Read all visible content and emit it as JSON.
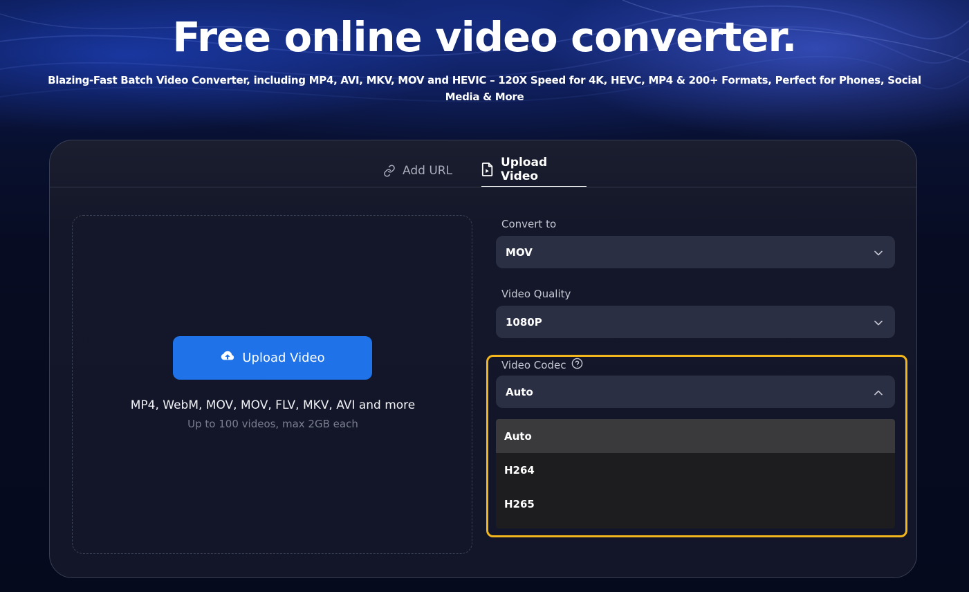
{
  "hero": {
    "title": "Free online video converter.",
    "subtitle": "Blazing-Fast Batch Video Converter, including MP4, AVI, MKV, MOV and HEVIC – 120X Speed for 4K, HEVC, MP4 & 200+ Formats, Perfect for Phones, Social Media & More"
  },
  "tabs": [
    {
      "label": "Add URL",
      "icon": "link-icon",
      "active": false
    },
    {
      "label": "Upload Video",
      "icon": "file-video-icon",
      "active": true
    }
  ],
  "upload": {
    "button_label": "Upload Video",
    "button_icon": "cloud-upload-icon",
    "formats": "MP4, WebM, MOV, MOV, FLV, MKV, AVI and more",
    "limits": "Up to 100 videos, max 2GB each"
  },
  "convert_to": {
    "label": "Convert to",
    "value": "MOV"
  },
  "video_quality": {
    "label": "Video Quality",
    "value": "1080P"
  },
  "video_codec": {
    "label": "Video Codec",
    "help_icon": "question-circle-icon",
    "value": "Auto",
    "expanded": true,
    "options": [
      "Auto",
      "H264",
      "H265"
    ],
    "selected_option": "Auto"
  },
  "colors": {
    "accent": "#1f72e8",
    "highlight": "#f3b61d",
    "card": "#131729",
    "select": "#2b2f44"
  }
}
